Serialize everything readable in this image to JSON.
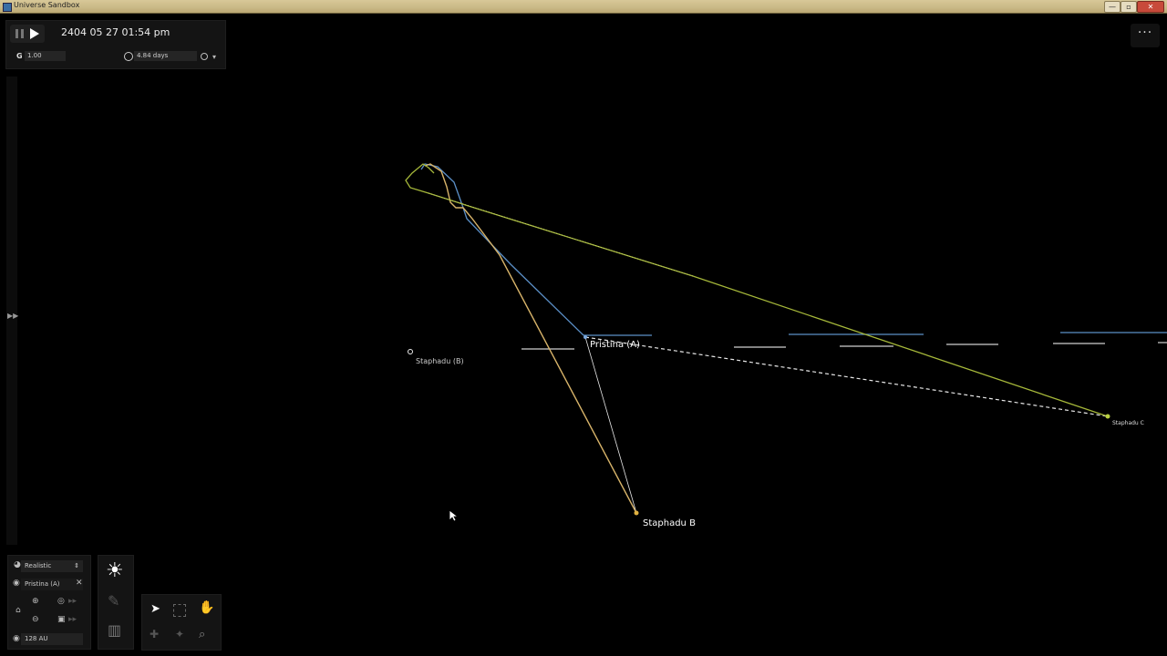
{
  "window": {
    "title": "Universe Sandbox",
    "min": "—",
    "max": "▫",
    "close": "✕"
  },
  "time": {
    "datetime": "2404 05 27 01:54 pm"
  },
  "params": {
    "g_label": "G",
    "g_value": "1.00",
    "speed_value": "4.84 days"
  },
  "menu": {
    "more_label": "···"
  },
  "bottom": {
    "view_mode": "Realistic",
    "focus_body": "Pristina (A)",
    "scale": "128 AU"
  },
  "bodies": {
    "pristina_a": "Pristina (A)",
    "staphadu_b": "Staphadu B",
    "staphadu_c": "Staphadu C",
    "overlap_label": "Staphadu (B)"
  },
  "colors": {
    "orbit_blue": "#5b8fc7",
    "orbit_gold": "#d8b46a",
    "orbit_green": "#a6b83a",
    "background": "#000000"
  },
  "icons": [
    "pause-icon",
    "play-icon",
    "speed-icon",
    "target-icon",
    "chevron-down-icon",
    "more-icon",
    "palette-icon",
    "eye-icon",
    "close-icon",
    "home-icon",
    "zoom-in-icon",
    "zoom-out-icon",
    "camera-icon",
    "sun-icon",
    "chart-icon",
    "cursor-icon",
    "select-icon",
    "hand-icon",
    "search-icon"
  ]
}
